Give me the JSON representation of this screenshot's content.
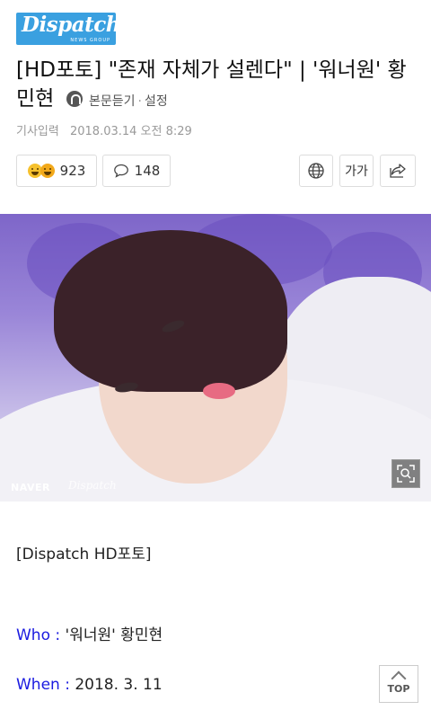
{
  "logo": {
    "text": "Dispatch",
    "sub": "NEWS GROUP"
  },
  "article": {
    "title_main": "[HD포토] \"존재 자체가 설렌다\" | '워너원' 황민현",
    "listen_label": "본문듣기",
    "separator": "·",
    "settings_label": "설정",
    "date_label": "기사입력",
    "date_value": "2018.03.14 오전 8:29"
  },
  "actions": {
    "reaction_count": "923",
    "comment_count": "148",
    "font_label": "가가"
  },
  "photo": {
    "watermark_naver": "NAVER",
    "watermark_dispatch": "Dispatch"
  },
  "body": {
    "hd_line": "[Dispatch HD포토]",
    "who_key": "Who : ",
    "who_value": "'워너원' 황민현",
    "when_key": "When : ",
    "when_value": "2018. 3. 11"
  },
  "top_button": {
    "label": "TOP"
  },
  "colors": {
    "logo_bg": "#3aa0e0",
    "key_blue": "#1a1ae0"
  }
}
